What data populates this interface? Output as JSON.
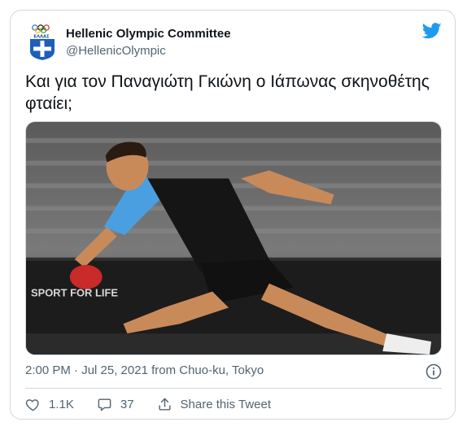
{
  "account": {
    "display_name": "Hellenic Olympic Committee",
    "handle": "@HellenicOlympic",
    "avatar_text": "ΕΛΛΑΣ",
    "avatar_icon": "hellenic-olympic-emblem"
  },
  "tweet": {
    "text": "Και για τον Παναγιώτη Γκιώνη ο Ιάπωνας σκηνοθέτης φταίει;",
    "timestamp": "2:00 PM · Jul 25, 2021 from Chuo-ku, Tokyo"
  },
  "media": {
    "description_icon": "table-tennis-photo",
    "banner_text": "SPORT FOR LIFE"
  },
  "actions": {
    "like_count": "1.1K",
    "reply_count": "37",
    "share_label": "Share this Tweet"
  },
  "colors": {
    "brand": "#1d9bf0",
    "text": "#0f1419",
    "secondary": "#536471",
    "border": "#cfd9de"
  }
}
